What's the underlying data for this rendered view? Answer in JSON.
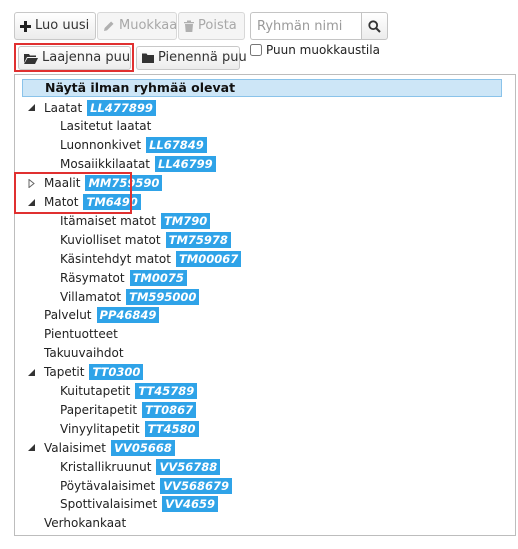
{
  "toolbar": {
    "new_label": "Luo uusi",
    "edit_label": "Muokkaa",
    "delete_label": "Poista",
    "expand_label": "Laajenna puu",
    "collapse_label": "Pienennä puu",
    "search_placeholder": "Ryhmän nimi",
    "edit_mode_label": "Puun muokkaustila"
  },
  "tree": {
    "header": "Näytä ilman ryhmää olevat",
    "rows": [
      {
        "label": "Laatat",
        "code": "LL477899",
        "level": 0,
        "state": "expanded"
      },
      {
        "label": "Lasitetut laatat",
        "level": 1
      },
      {
        "label": "Luonnonkivet",
        "code": "LL67849",
        "level": 1
      },
      {
        "label": "Mosaiikkilaatat",
        "code": "LL46799",
        "level": 1
      },
      {
        "label": "Maalit",
        "code": "MM759590",
        "level": 0,
        "state": "collapsed"
      },
      {
        "label": "Matot",
        "code": "TM6490",
        "level": 0,
        "state": "expanded"
      },
      {
        "label": "Itämaiset matot",
        "code": "TM790",
        "level": 1
      },
      {
        "label": "Kuviolliset matot",
        "code": "TM75978",
        "level": 1
      },
      {
        "label": "Käsintehdyt matot",
        "code": "TM00067",
        "level": 1
      },
      {
        "label": "Räsymatot",
        "code": "TM0075",
        "level": 1
      },
      {
        "label": "Villamatot",
        "code": "TM595000",
        "level": 1
      },
      {
        "label": "Palvelut",
        "code": "PP46849",
        "level": 0
      },
      {
        "label": "Pientuotteet",
        "level": 0
      },
      {
        "label": "Takuuvaihdot",
        "level": 0
      },
      {
        "label": "Tapetit",
        "code": "TT0300",
        "level": 0,
        "state": "expanded"
      },
      {
        "label": "Kuitutapetit",
        "code": "TT45789",
        "level": 1
      },
      {
        "label": "Paperitapetit",
        "code": "TT0867",
        "level": 1
      },
      {
        "label": "Vinyylitapetit",
        "code": "TT4580",
        "level": 1
      },
      {
        "label": "Valaisimet",
        "code": "VV05668",
        "level": 0,
        "state": "expanded"
      },
      {
        "label": "Kristallikruunut",
        "code": "VV56788",
        "level": 1
      },
      {
        "label": "Pöytävalaisimet",
        "code": "VV568679",
        "level": 1
      },
      {
        "label": "Spottivalaisimet",
        "code": "VV4659",
        "level": 1
      },
      {
        "label": "Verhokankaat",
        "level": 0
      }
    ]
  }
}
